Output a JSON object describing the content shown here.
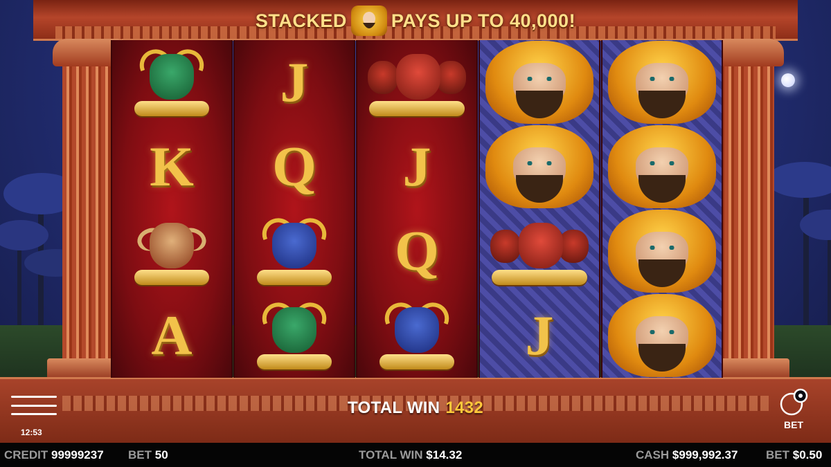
{
  "header": {
    "banner_left": "STACKED",
    "banner_right": "PAYS UP TO 40,000!",
    "banner_symbol": "hero-symbol-icon"
  },
  "reels": [
    [
      "boar",
      "K",
      "ram",
      "A"
    ],
    [
      "J",
      "Q",
      "bull",
      "boar"
    ],
    [
      "cerberus",
      "J",
      "Q",
      "bull"
    ],
    [
      "hero",
      "hero",
      "cerberus",
      "J"
    ],
    [
      "hero",
      "hero",
      "hero",
      "hero"
    ]
  ],
  "win_display": {
    "label": "TOTAL WIN",
    "value": "1432"
  },
  "controls": {
    "menu_icon": "hamburger-menu-icon",
    "bet_label": "BET",
    "bet_icon": "coin-gear-icon",
    "clock": "12:53"
  },
  "status_bar": {
    "credit_label": "CREDIT",
    "credit_value": "99999237",
    "bet_label": "BET",
    "bet_value": "50",
    "total_win_label": "TOTAL WIN",
    "total_win_value": "$14.32",
    "cash_label": "CASH",
    "cash_value": "$999,992.37",
    "bet_cash_label": "BET",
    "bet_cash_value": "$0.50"
  },
  "colors": {
    "accent_gold": "#ffc83a",
    "temple_red": "#b5452a",
    "reel_red": "#b0141a"
  }
}
